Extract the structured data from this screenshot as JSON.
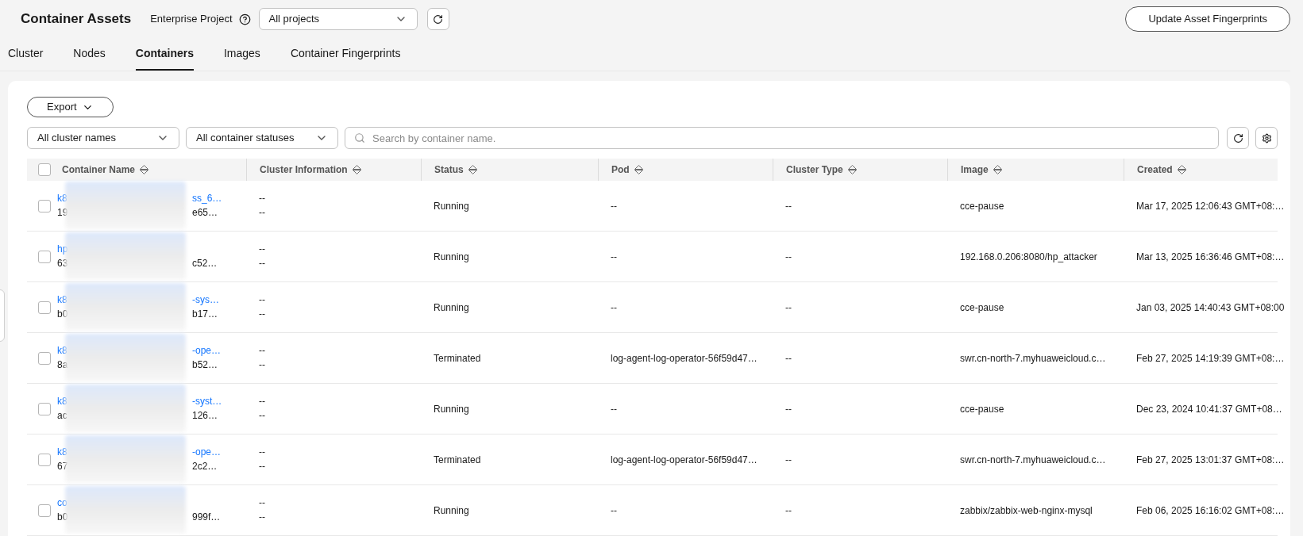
{
  "header": {
    "title": "Container Assets",
    "project_label": "Enterprise Project",
    "project_select": "All projects",
    "update_button": "Update Asset Fingerprints"
  },
  "tabs": [
    {
      "label": "Cluster",
      "selected": false
    },
    {
      "label": "Nodes",
      "selected": false
    },
    {
      "label": "Containers",
      "selected": true
    },
    {
      "label": "Images",
      "selected": false
    },
    {
      "label": "Container Fingerprints",
      "selected": false
    }
  ],
  "toolbar": {
    "export_button": "Export",
    "cluster_filter": "All cluster names",
    "status_filter": "All container statuses",
    "search": {
      "placeholder": "Search by container name."
    }
  },
  "table": {
    "select_all_checked": false,
    "columns": [
      "Container Name",
      "Cluster Information",
      "Status",
      "Pod",
      "Cluster Type",
      "Image",
      "Created"
    ],
    "rows": [
      {
        "checked": false,
        "name_start": "k8",
        "name_end": "ss_6…",
        "id_start": "19",
        "id_end": "e65…",
        "cluster_info": [
          "--",
          "--"
        ],
        "status": "Running",
        "pod": "--",
        "cluster_type": "--",
        "image": "cce-pause",
        "created": "Mar 17, 2025 12:06:43 GMT+08:…"
      },
      {
        "checked": false,
        "name_start": "hp",
        "name_end": "",
        "id_start": "63",
        "id_end": "c52…",
        "cluster_info": [
          "--",
          "--"
        ],
        "status": "Running",
        "pod": "--",
        "cluster_type": "--",
        "image": "192.168.0.206:8080/hp_attacker",
        "created": "Mar 13, 2025 16:36:46 GMT+08:…"
      },
      {
        "checked": false,
        "name_start": "k8",
        "name_end": "-sys…",
        "id_start": "b0",
        "id_end": "b17…",
        "cluster_info": [
          "--",
          "--"
        ],
        "status": "Running",
        "pod": "--",
        "cluster_type": "--",
        "image": "cce-pause",
        "created": "Jan 03, 2025 14:40:43 GMT+08:00"
      },
      {
        "checked": false,
        "name_start": "k8",
        "name_end": "-ope…",
        "id_start": "8a",
        "id_end": "b52…",
        "cluster_info": [
          "--",
          "--"
        ],
        "status": "Terminated",
        "pod": "log-agent-log-operator-56f59d47…",
        "cluster_type": "--",
        "image": "swr.cn-north-7.myhuaweicloud.c…",
        "created": "Feb 27, 2025 14:19:39 GMT+08:…"
      },
      {
        "checked": false,
        "name_start": "k8",
        "name_end": "-syst…",
        "id_start": "ac",
        "id_end": "126…",
        "cluster_info": [
          "--",
          "--"
        ],
        "status": "Running",
        "pod": "--",
        "cluster_type": "--",
        "image": "cce-pause",
        "created": "Dec 23, 2024 10:41:37 GMT+08…"
      },
      {
        "checked": false,
        "name_start": "k8",
        "name_end": "-ope…",
        "id_start": "67",
        "id_end": "2c2…",
        "cluster_info": [
          "--",
          "--"
        ],
        "status": "Terminated",
        "pod": "log-agent-log-operator-56f59d47…",
        "cluster_type": "--",
        "image": "swr.cn-north-7.myhuaweicloud.c…",
        "created": "Feb 27, 2025 13:01:37 GMT+08:…"
      },
      {
        "checked": false,
        "name_start": "co",
        "name_end": "",
        "id_start": "b0",
        "id_end": "999f…",
        "cluster_info": [
          "--",
          "--"
        ],
        "status": "Running",
        "pod": "--",
        "cluster_type": "--",
        "image": "zabbix/zabbix-web-nginx-mysql",
        "created": "Feb 06, 2025 16:16:02 GMT+08:…"
      }
    ]
  }
}
